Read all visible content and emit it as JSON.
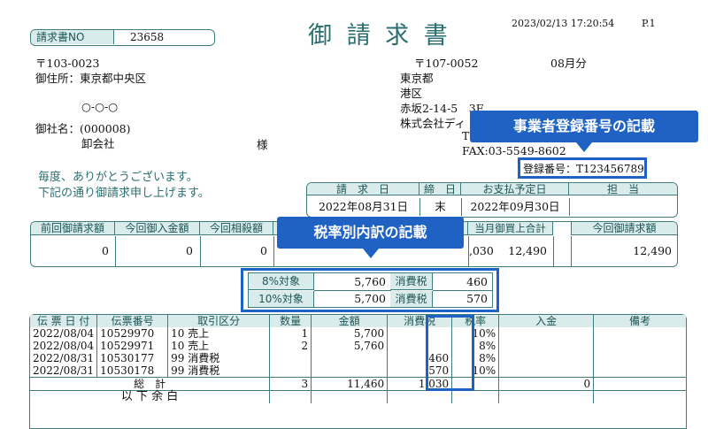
{
  "header": {
    "title": "御 請 求 書",
    "datetime": "2023/02/13 17:20:54",
    "page": "P.1",
    "invoice_no_label": "請求書NO",
    "invoice_no": "23658"
  },
  "recipient": {
    "postal": "〒103-0023",
    "address": "御住所：東京都中央区",
    "address2": "○-○-○",
    "company_line": "御社名：(000008)",
    "company_name": "卸会社",
    "honorific": "様"
  },
  "sender": {
    "postal": "〒107-0052",
    "month": "08月分",
    "line1": "東京都",
    "line2": "港区",
    "line3": "赤坂2-14-5　3F",
    "line4": "株式会社ディ",
    "line5": "T",
    "fax": "FAX:03-5549-8602",
    "registration": "登録番号：T123456789"
  },
  "greeting": {
    "line1": "毎度、ありがとうございます。",
    "line2": "下記の通り御請求申し上げます。"
  },
  "summary": {
    "headers": [
      "請　求　日",
      "締　日",
      "お支払予定日",
      "担　当"
    ],
    "values": [
      "2022年08月31日",
      "末",
      "2022年09月30日",
      ""
    ]
  },
  "balance": {
    "headers": [
      "前回御請求額",
      "今回御入金額",
      "今回相殺額",
      "",
      "税",
      "当月御買上合計",
      "今回御請求額"
    ],
    "values": [
      "0",
      "0",
      "0",
      "",
      "11,030",
      "12,490",
      "12,490"
    ],
    "visible_tax": ",030"
  },
  "tax_breakdown": {
    "rows": [
      {
        "label": "8%対象",
        "amount": "5,760",
        "tax_label": "消費税",
        "tax": "460"
      },
      {
        "label": "10%対象",
        "amount": "5,700",
        "tax_label": "消費税",
        "tax": "570"
      }
    ]
  },
  "detail": {
    "headers": [
      "伝 票 日 付",
      "伝票番号",
      "取引区分",
      "数量",
      "金額",
      "消費税",
      "税率",
      "入金",
      "備考"
    ],
    "rows": [
      [
        "2022/08/04",
        "10529970",
        "10 売上",
        "1",
        "5,700",
        "",
        "10%",
        "",
        ""
      ],
      [
        "2022/08/04",
        "10529971",
        "10 売上",
        "2",
        "5,760",
        "",
        "8%",
        "",
        ""
      ],
      [
        "2022/08/31",
        "10530177",
        "99 消費税",
        "",
        "",
        "460",
        "8%",
        "",
        ""
      ],
      [
        "2022/08/31",
        "10530178",
        "99 消費税",
        "",
        "",
        "570",
        "10%",
        "",
        ""
      ]
    ],
    "total_label": "総　計",
    "total_qty": "3",
    "total_amount": "11,460",
    "total_tax": "1,030",
    "total_payment": "0",
    "remainder": "以 下 余 白"
  },
  "callouts": {
    "registration": "事業者登録番号の記載",
    "tax_breakdown": "税率別内訳の記載"
  },
  "colors": {
    "frame": "#3f7d7c",
    "header_fill": "#d9ebeb",
    "callout": "#1f62c4"
  }
}
